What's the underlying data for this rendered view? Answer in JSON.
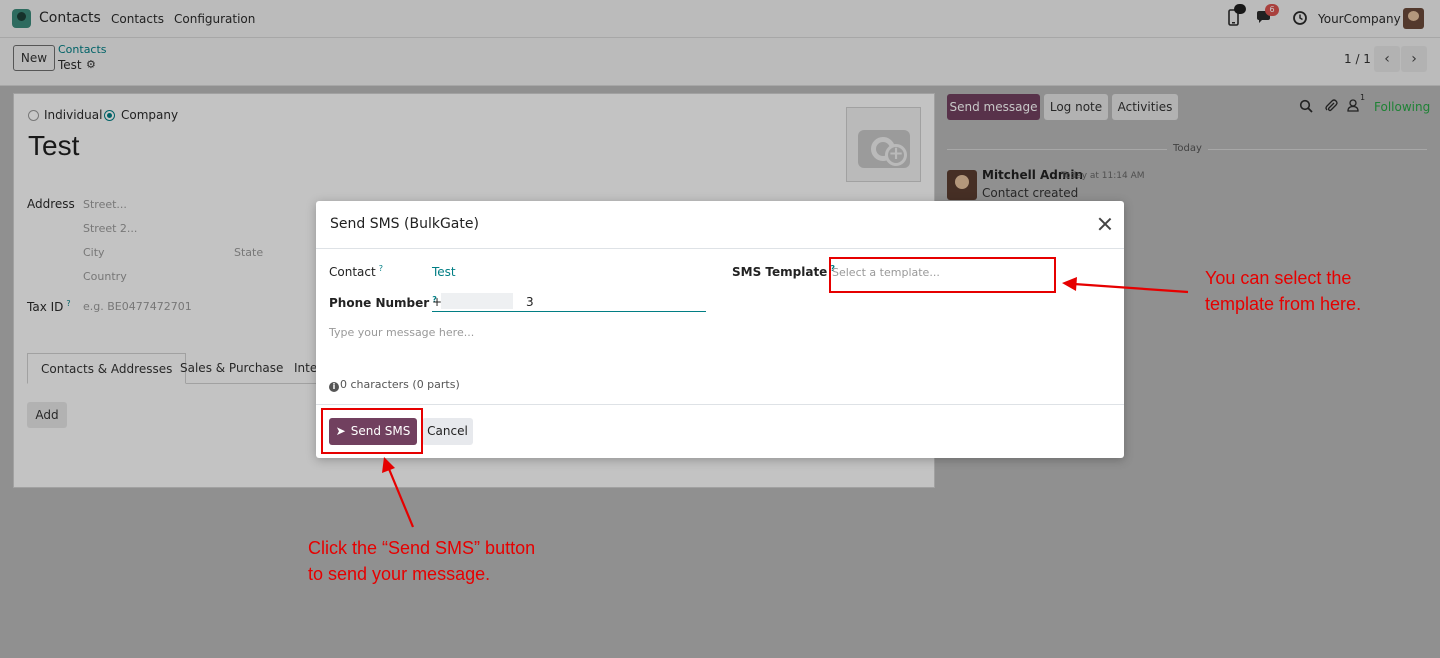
{
  "navbar": {
    "app_name": "Contacts",
    "menu": [
      "Contacts",
      "Configuration"
    ],
    "chat_badge": "6",
    "company": "YourCompany"
  },
  "control": {
    "new_label": "New",
    "breadcrumb_parent": "Contacts",
    "breadcrumb_current": "Test",
    "pager": "1 / 1"
  },
  "form": {
    "type_options": [
      "Individual",
      "Company"
    ],
    "selected_type": "Company",
    "name": "Test",
    "address_label": "Address",
    "street_placeholder": "Street...",
    "street2_placeholder": "Street 2...",
    "city_placeholder": "City",
    "state_placeholder": "State",
    "country_placeholder": "Country",
    "taxid_label": "Tax ID",
    "taxid_help": "?",
    "taxid_placeholder": "e.g. BE0477472701",
    "tabs": [
      "Contacts & Addresses",
      "Sales & Purchase",
      "Inte"
    ],
    "add_label": "Add"
  },
  "chatter": {
    "send_message": "Send message",
    "log_note": "Log note",
    "activities": "Activities",
    "followers_count": "1",
    "following": "Following",
    "today": "Today",
    "author": "Mitchell Admin",
    "time": "Today at 11:14 AM",
    "body": "Contact created"
  },
  "modal": {
    "title": "Send SMS (BulkGate)",
    "contact_label": "Contact",
    "help_mark": "?",
    "contact_value": "Test",
    "phone_label": "Phone Number",
    "phone_value": "+9                    3",
    "template_label": "SMS Template",
    "template_placeholder": "Select a template...",
    "message_placeholder": "Type your message here...",
    "char_count": "0 characters (0 parts)",
    "send_label": "Send SMS",
    "cancel_label": "Cancel"
  },
  "annotations": {
    "template_note_line1": "You can select the",
    "template_note_line2": "template from here.",
    "send_note_line1": "Click the “Send SMS” button",
    "send_note_line2": "to send your message.",
    "color": "#e60000"
  }
}
